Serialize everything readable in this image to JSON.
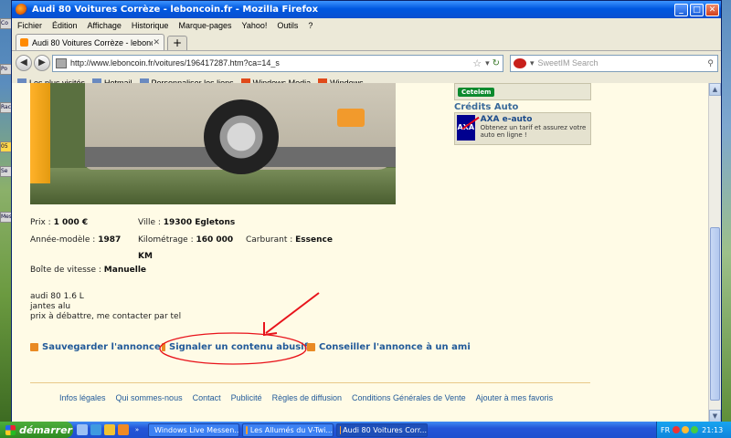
{
  "window": {
    "title": "Audi 80 Voitures Corrèze - leboncoin.fr - Mozilla Firefox",
    "min_label": "_",
    "max_label": "□",
    "close_label": "✕"
  },
  "menu": [
    "Fichier",
    "Édition",
    "Affichage",
    "Historique",
    "Marque-pages",
    "Yahoo!",
    "Outils",
    "?"
  ],
  "tab": {
    "label": "Audi 80 Voitures Corrèze - leboncoin.fr",
    "close": "✕",
    "new": "+"
  },
  "nav": {
    "back": "◀",
    "forward": "▶",
    "url": "http://www.leboncoin.fr/voitures/196417287.htm?ca=14_s",
    "search_placeholder": "SweetIM Search"
  },
  "bookmarks": [
    "Les plus visités",
    "Hotmail",
    "Personnaliser les liens",
    "Windows Media",
    "Windows"
  ],
  "ads": {
    "cetelem": "Cetelem",
    "credits_title": "Crédits Auto",
    "axa_logo": "AXA",
    "axa_title": "AXA e-auto",
    "axa_text": "Obtenez un tarif et assurez votre auto en ligne !"
  },
  "listing": {
    "price_label": "Prix :",
    "price": "1 000 €",
    "city_label": "Ville :",
    "city": "19300 Egletons",
    "year_label": "Année-modèle :",
    "year": "1987",
    "km_label": "Kilométrage :",
    "km": "160 000",
    "km_unit": "KM",
    "fuel_label": "Carburant :",
    "fuel": "Essence",
    "gearbox_label": "Boîte de vitesse :",
    "gearbox": "Manuelle",
    "description": [
      "audi 80 1.6 L",
      "jantes alu",
      "prix à débattre, me contacter par tel"
    ]
  },
  "actions": {
    "save": "Sauvegarder l'annonce",
    "report": "Signaler un contenu abusif",
    "share": "Conseiller l'annonce à un ami"
  },
  "footer": [
    "Infos légales",
    "Qui sommes-nous",
    "Contact",
    "Publicité",
    "Règles de diffusion",
    "Conditions Générales de Vente",
    "Ajouter à mes favoris"
  ],
  "taskbar": {
    "start": "démarrer",
    "tasks": [
      "Windows Live Messen...",
      "Les Allumés du V-Twi...",
      "Audi 80 Voitures Corr..."
    ],
    "lang": "FR",
    "clock": "21:13"
  },
  "colors": {
    "link": "#225a99",
    "page_bg": "#fffbe6",
    "annotation": "#e8131b"
  }
}
